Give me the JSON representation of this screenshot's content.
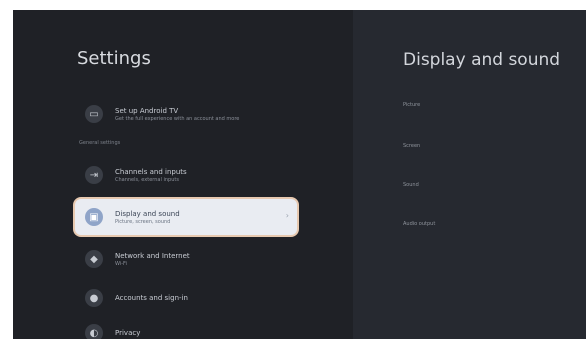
{
  "left": {
    "title": "Settings",
    "items": [
      {
        "label": "Set up Android TV",
        "sub": "Get the full experience with an account and more"
      },
      {
        "label": "Channels and inputs",
        "sub": "Channels, external inputs"
      },
      {
        "label": "Display and sound",
        "sub": "Picture, screen, sound"
      },
      {
        "label": "Network and Internet",
        "sub": "Wi-Fi"
      },
      {
        "label": "Accounts and sign-in",
        "sub": ""
      },
      {
        "label": "Privacy",
        "sub": ""
      }
    ],
    "section_header": "General settings"
  },
  "right": {
    "title": "Display and sound",
    "items": [
      "Picture",
      "Screen",
      "Sound",
      "Audio output"
    ]
  },
  "icons": {
    "setup": "tv-icon",
    "channels": "input-icon",
    "display": "display-icon",
    "network": "wifi-icon",
    "accounts": "account-icon",
    "privacy": "shield-icon"
  },
  "colors": {
    "screen_bg": "#1f2126",
    "panel_bg": "#262930",
    "selected_bg": "#e9ecf2",
    "selected_outline": "#e7c9b0"
  }
}
